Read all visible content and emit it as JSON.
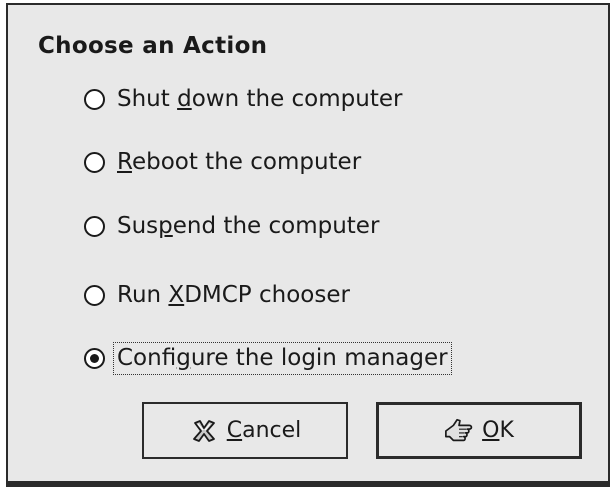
{
  "dialog": {
    "heading": "Choose an Action",
    "options": [
      {
        "pre": "Shut ",
        "mn": "d",
        "post": "own the computer",
        "checked": false
      },
      {
        "pre": "",
        "mn": "R",
        "post": "eboot the computer",
        "checked": false
      },
      {
        "pre": "Sus",
        "mn": "p",
        "post": "end the computer",
        "checked": false
      },
      {
        "pre": "Run ",
        "mn": "X",
        "post": "DMCP chooser",
        "checked": false
      },
      {
        "pre": "Confi",
        "mn": "g",
        "post": "ure the login manager",
        "checked": true
      }
    ],
    "buttons": {
      "cancel": {
        "pre": "",
        "mn": "C",
        "post": "ancel",
        "icon": "cancel-x-icon"
      },
      "ok": {
        "pre": "",
        "mn": "O",
        "post": "K",
        "icon": "ok-hand-icon"
      }
    }
  }
}
